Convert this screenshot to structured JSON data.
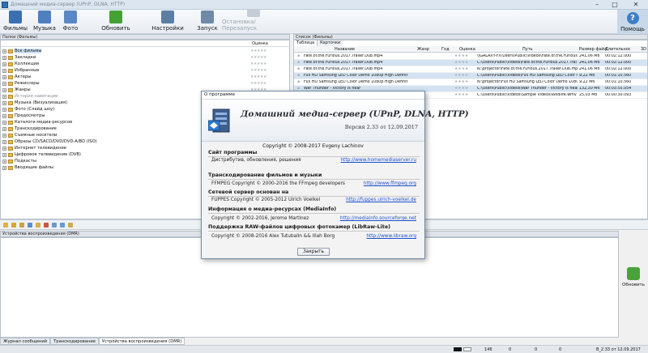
{
  "window": {
    "title": "Домашний медиа-сервер (UPnP, DLNA, HTTP)"
  },
  "toolbar": {
    "films": "Фильмы",
    "music": "Музыка",
    "photo": "Фото",
    "refresh": "Обновить",
    "settings": "Настройки",
    "start": "Запуск",
    "stop_restart": "Остановка/Перезапуск",
    "help": "Помощь"
  },
  "left": {
    "header": "Папки (Фильмы)",
    "col_rating": "Оценка",
    "items": [
      {
        "label": "Все фильмы",
        "selected": true
      },
      {
        "label": "Закладки"
      },
      {
        "label": "Коллекции"
      },
      {
        "label": "Избранные"
      },
      {
        "label": "Актеры"
      },
      {
        "label": "Режиссеры"
      },
      {
        "label": "Жанры"
      },
      {
        "label": "История навигации",
        "dim": true
      },
      {
        "label": "Музыка (Визуализация)"
      },
      {
        "label": "Фото (Слайд шоу)"
      },
      {
        "label": "Предосмотры"
      },
      {
        "label": "Каталоги медиа-ресурсов"
      },
      {
        "label": "Транскодирование"
      },
      {
        "label": "Съемные носители"
      },
      {
        "label": "Образы CD/SACD/DVD/DVD-A/BD (ISO)"
      },
      {
        "label": "Интернет телевидение"
      },
      {
        "label": "Цифровое телевидение (DVB)"
      },
      {
        "label": "Подкасты"
      },
      {
        "label": "Вводящие файлы"
      }
    ]
  },
  "right": {
    "header": "Список (Фильмы)",
    "tabs": [
      "Таблица",
      "Карточки"
    ],
    "columns": [
      "Название",
      "Жанр",
      "Год",
      "Оценка",
      "Путь",
      "Размер файл",
      "Длительнос",
      "3D"
    ],
    "rows": [
      {
        "name": "Fate.of.the.Furious.2017.Trailer.Dub.mp4",
        "path": "\\\\GALAXY-FX\\Users\\Public\\Videos\\Fate.of.the.Furious",
        "size": "241,06 Мб",
        "dur": "00:02:12.000"
      },
      {
        "name": "Fate.of.the.Furious.2017.Trailer.Dub.mp4",
        "path": "C:\\Users\\Public\\Videos\\Fate.of.the.Furious.2017.Trai",
        "size": "241,06 Мб",
        "dur": "00:02:12.000"
      },
      {
        "name": "Fate.of.the.Furious.2017.Trailer.Dub.mp4",
        "path": "N:\\projector\\Fate.of.the.Furious.2017.Trailer.Dub.mp",
        "size": "241,06 Мб",
        "dur": "00:02:12.000"
      },
      {
        "name": "Full HD Samsung LED Color Demo 1080p High Definit",
        "path": "C:\\Users\\Public\\Videos\\Full HD Samsung LED Color I",
        "size": "9,22 Мб",
        "dur": "00:01:10.560"
      },
      {
        "name": "Full HD Samsung LED Color Demo 1080p High Definit",
        "path": "N:\\projector\\Full HD Samsung LED Color Demo 1080",
        "size": "9,22 Мб",
        "dur": "00:01:10.560"
      },
      {
        "name": "War Thunder - Victory is near",
        "path": "C:\\Users\\Public\\Videos\\War Thunder - Victory is near",
        "size": "132,30 Мб",
        "dur": "00:03:55.054"
      },
      {
        "name": "Wildlife.wmv",
        "path": "C:\\Users\\Public\\Videos\\Sample Videos\\Wildlife.wmv",
        "size": "25,03 Мб",
        "dur": "00:00:30.093"
      }
    ]
  },
  "dmr": {
    "header": "Устройства воспроизведения (DMR)",
    "refresh": "Обновить"
  },
  "bottom_tabs": [
    "Журнал сообщений",
    "Транскодирование",
    "Устройства воспроизведения (DMR)"
  ],
  "status": {
    "count": "146",
    "zero1": "0",
    "zero2": "0",
    "zero3": "0",
    "version": "В_2.33 от 12.09.2017"
  },
  "dialog": {
    "title": "О программе",
    "app_title": "Домашний медиа-сервер (UPnP, DLNA, HTTP)",
    "version": "Версия 2.33 от 12.09.2017",
    "copyright": "Copyright © 2008-2017 Evgeny Lachinov",
    "site_h": "Сайт программы",
    "site_t": "Дистрибутив, обновления, решения",
    "site_l": "http://www.homemediaserver.ru",
    "trans_h": "Транскодирование фильмов и музыки",
    "trans_t": "FFMPEG Copyright © 2000-2016 the FFmpeg developers",
    "trans_l": "http://www.ffmpeg.org",
    "net_h": "Сетевой сервер основан на",
    "net_t": "FUPPES Copyright © 2005-2012 Ulrich Voelkel",
    "net_l": "http://fuppes.ulrich-voelkel.de",
    "mi_h": "Информация о медиа-ресурсах (MediaInfo)",
    "mi_t": "Copyright © 2002-2016, Jerome Martinez",
    "mi_l": "http://mediainfo.sourceforge.net",
    "raw_h": "Поддержка RAW-файлов цифровых фотокамер (LibRaw-Lite)",
    "raw_t": "Copyright © 2008-2016 Alex Tutubalin && Illah Borg",
    "raw_l": "http://www.libraw.org",
    "close": "Закрыть"
  }
}
